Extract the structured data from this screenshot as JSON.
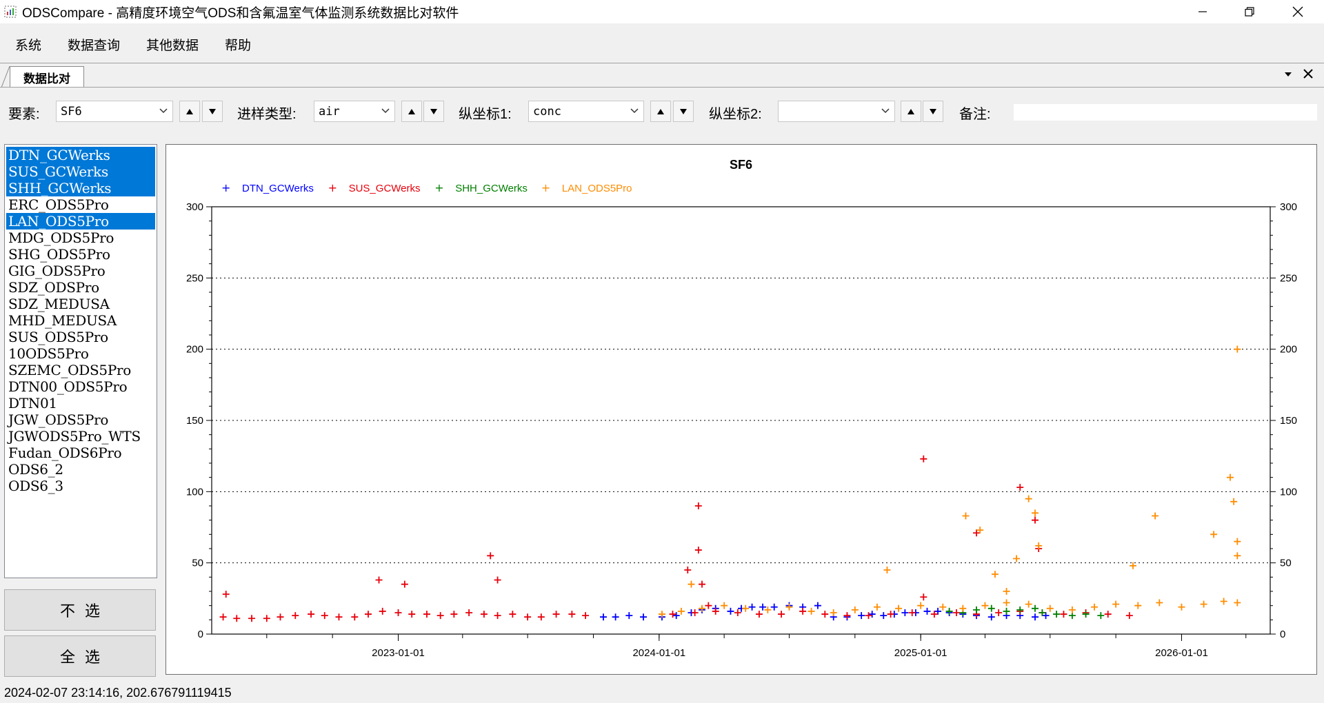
{
  "window": {
    "title": "ODSCompare - 高精度环境空气ODS和含氟温室气体监测系统数据比对软件"
  },
  "menu": [
    "系统",
    "数据查询",
    "其他数据",
    "帮助"
  ],
  "tab": {
    "label": "数据比对"
  },
  "toolbar": {
    "element_label": "要素:",
    "element_value": "SF6",
    "sample_type_label": "进样类型:",
    "sample_type_value": "air",
    "y1_label": "纵坐标1:",
    "y1_value": "conc",
    "y2_label": "纵坐标2:",
    "y2_value": "",
    "note_label": "备注:"
  },
  "station_list": {
    "items": [
      {
        "label": "DTN_GCWerks",
        "selected": true
      },
      {
        "label": "SUS_GCWerks",
        "selected": true
      },
      {
        "label": "SHH_GCWerks",
        "selected": true
      },
      {
        "label": "ERC_ODS5Pro",
        "selected": false
      },
      {
        "label": "LAN_ODS5Pro",
        "selected": true
      },
      {
        "label": "MDG_ODS5Pro",
        "selected": false
      },
      {
        "label": "SHG_ODS5Pro",
        "selected": false
      },
      {
        "label": "GIG_ODS5Pro",
        "selected": false
      },
      {
        "label": "SDZ_ODSPro",
        "selected": false
      },
      {
        "label": "SDZ_MEDUSA",
        "selected": false
      },
      {
        "label": "MHD_MEDUSA",
        "selected": false
      },
      {
        "label": "SUS_ODS5Pro",
        "selected": false
      },
      {
        "label": "10ODS5Pro",
        "selected": false
      },
      {
        "label": "SZEMC_ODS5Pro",
        "selected": false
      },
      {
        "label": "DTN00_ODS5Pro",
        "selected": false
      },
      {
        "label": "DTN01",
        "selected": false
      },
      {
        "label": "JGW_ODS5Pro",
        "selected": false
      },
      {
        "label": "JGWODS5Pro_WTS",
        "selected": false
      },
      {
        "label": "Fudan_ODS6Pro",
        "selected": false
      },
      {
        "label": "ODS6_2",
        "selected": false
      },
      {
        "label": "ODS6_3",
        "selected": false
      }
    ]
  },
  "buttons": {
    "deselect_all": "不选",
    "select_all": "全选"
  },
  "chart_data": {
    "type": "scatter",
    "title": "SF6",
    "xlabel": "",
    "ylabel": "",
    "marker": "+",
    "xlim": [
      "2022-04-15",
      "2026-05-05"
    ],
    "ylim": [
      0,
      300
    ],
    "x_ticks": [
      "2023-01-01",
      "2024-01-01",
      "2025-01-01",
      "2026-01-01"
    ],
    "y_ticks": [
      0,
      50,
      100,
      150,
      200,
      250,
      300
    ],
    "y_tick_labels": [
      "0",
      "50",
      "100",
      "150",
      "200",
      "250",
      "300"
    ],
    "grid": "horizontal dotted",
    "legend_position": "top-left",
    "series": [
      {
        "name": "DTN_GCWerks",
        "color": "#0000ff",
        "x": [
          "2023-10-15",
          "2023-11-01",
          "2023-11-20",
          "2023-12-10",
          "2024-01-05",
          "2024-01-25",
          "2024-02-15",
          "2024-03-01",
          "2024-03-20",
          "2024-04-10",
          "2024-04-25",
          "2024-05-10",
          "2024-05-25",
          "2024-06-10",
          "2024-07-01",
          "2024-07-20",
          "2024-08-10",
          "2024-09-01",
          "2024-09-20",
          "2024-10-10",
          "2024-10-25",
          "2024-11-10",
          "2024-11-25",
          "2024-12-10",
          "2024-12-25",
          "2025-01-10",
          "2025-01-25",
          "2025-02-10",
          "2025-03-01",
          "2025-03-20",
          "2025-04-10",
          "2025-05-01",
          "2025-05-20",
          "2025-06-10",
          "2025-06-25"
        ],
        "y": [
          12,
          12,
          13,
          12,
          12,
          13,
          15,
          17,
          18,
          16,
          18,
          19,
          19,
          19,
          20,
          19,
          20,
          12,
          12,
          13,
          14,
          13,
          14,
          15,
          15,
          16,
          16,
          15,
          14,
          13,
          12,
          13,
          13,
          12,
          13
        ]
      },
      {
        "name": "SUS_GCWerks",
        "color": "#e8000b",
        "x": [
          "2022-05-01",
          "2022-05-20",
          "2022-06-10",
          "2022-07-01",
          "2022-07-20",
          "2022-08-10",
          "2022-09-01",
          "2022-09-20",
          "2022-10-10",
          "2022-11-01",
          "2022-11-20",
          "2022-12-10",
          "2023-01-01",
          "2023-01-20",
          "2023-02-10",
          "2023-03-01",
          "2023-03-20",
          "2023-04-10",
          "2023-05-01",
          "2023-05-20",
          "2023-06-10",
          "2023-07-01",
          "2023-07-20",
          "2023-08-10",
          "2023-09-01",
          "2023-09-20",
          "2024-01-20",
          "2024-02-20",
          "2024-03-20",
          "2024-04-20",
          "2024-05-20",
          "2024-06-20",
          "2024-07-20",
          "2024-08-20",
          "2024-09-20",
          "2024-10-20",
          "2024-11-20",
          "2024-12-20",
          "2025-01-20",
          "2025-02-20",
          "2025-03-20",
          "2025-04-20",
          "2025-05-20",
          "2025-06-20",
          "2025-07-20",
          "2025-08-20",
          "2025-09-20",
          "2025-10-20",
          "2022-05-05",
          "2022-12-05",
          "2023-01-10",
          "2023-05-10",
          "2023-05-20",
          "2024-02-10",
          "2024-02-25",
          "2024-02-25",
          "2024-03-01",
          "2024-03-10",
          "2025-01-05",
          "2025-01-05",
          "2025-03-20",
          "2025-05-20",
          "2025-06-10",
          "2025-06-15"
        ],
        "y": [
          12,
          11,
          11,
          11,
          12,
          13,
          14,
          13,
          12,
          12,
          14,
          16,
          15,
          14,
          14,
          13,
          14,
          15,
          14,
          13,
          14,
          12,
          12,
          14,
          14,
          13,
          14,
          15,
          16,
          15,
          14,
          14,
          16,
          14,
          13,
          13,
          14,
          15,
          14,
          15,
          14,
          15,
          16,
          15,
          14,
          15,
          14,
          13,
          28,
          38,
          35,
          55,
          38,
          45,
          59,
          90,
          35,
          20,
          26,
          123,
          71,
          103,
          80,
          60
        ]
      },
      {
        "name": "SHH_GCWerks",
        "color": "#008000",
        "x": [
          "2025-02-10",
          "2025-03-01",
          "2025-03-20",
          "2025-04-10",
          "2025-05-01",
          "2025-05-20",
          "2025-06-10",
          "2025-06-20",
          "2025-07-10",
          "2025-08-01",
          "2025-08-20",
          "2025-09-10"
        ],
        "y": [
          16,
          15,
          17,
          18,
          16,
          17,
          18,
          15,
          14,
          13,
          14,
          13
        ]
      },
      {
        "name": "LAN_ODS5Pro",
        "color": "#ff8c00",
        "x": [
          "2024-01-05",
          "2024-02-01",
          "2024-03-01",
          "2024-04-01",
          "2024-05-01",
          "2024-06-01",
          "2024-07-01",
          "2024-08-01",
          "2024-09-01",
          "2024-10-01",
          "2024-11-01",
          "2024-12-01",
          "2025-01-01",
          "2025-02-01",
          "2025-03-01",
          "2025-04-01",
          "2025-05-01",
          "2025-06-01",
          "2025-07-01",
          "2025-08-01",
          "2025-09-01",
          "2025-10-01",
          "2025-11-01",
          "2025-12-01",
          "2026-01-01",
          "2026-02-01",
          "2026-03-01",
          "2026-03-20",
          "2024-02-15",
          "2024-11-15",
          "2025-03-05",
          "2025-03-25",
          "2025-04-15",
          "2025-05-01",
          "2025-05-15",
          "2025-06-01",
          "2025-06-10",
          "2025-06-15",
          "2025-10-25",
          "2025-11-25",
          "2026-02-15",
          "2026-03-10",
          "2026-03-15",
          "2026-03-20",
          "2026-03-20",
          "2026-03-20"
        ],
        "y": [
          14,
          16,
          18,
          20,
          18,
          17,
          19,
          16,
          15,
          17,
          19,
          18,
          20,
          19,
          18,
          20,
          22,
          21,
          18,
          17,
          19,
          21,
          20,
          22,
          19,
          21,
          23,
          22,
          35,
          45,
          83,
          73,
          42,
          30,
          53,
          95,
          85,
          62,
          48,
          83,
          70,
          110,
          93,
          65,
          200,
          55
        ]
      }
    ]
  },
  "status_bar": {
    "text": "2024-02-07 23:14:16, 202.676791119415"
  },
  "colors": {
    "selection": "#0078d7",
    "chart_border": "#000000"
  }
}
